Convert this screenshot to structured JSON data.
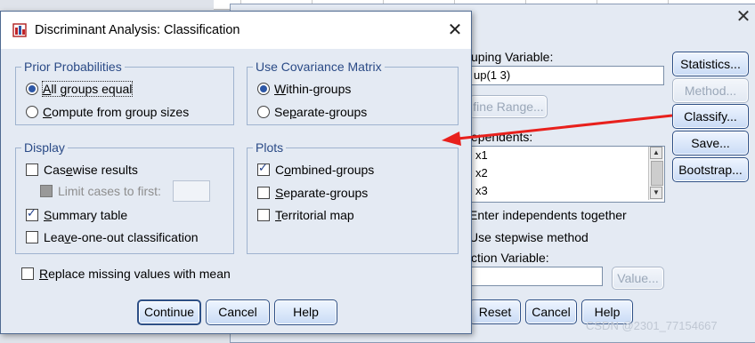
{
  "background_dialog": {
    "grouping_label": "uping Variable:",
    "grouping_value": "up(1 3)",
    "define_range_label": "fine Range...",
    "independents_label": "ependents:",
    "independents": [
      "x1",
      "x2",
      "x3"
    ],
    "enter_together_label": "Enter independents together",
    "stepwise_label": "Use stepwise method",
    "selection_label": "ction Variable:",
    "value_button": "Value...",
    "buttons": {
      "statistics": "Statistics...",
      "method": "Method...",
      "classify": "Classify...",
      "save": "Save...",
      "bootstrap": "Bootstrap..."
    },
    "bottom_buttons": {
      "reset": "Reset",
      "cancel": "Cancel",
      "help": "Help"
    },
    "close_glyph": "✕"
  },
  "dialog": {
    "title": "Discriminant Analysis: Classification",
    "close_glyph": "✕",
    "prior_probabilities": {
      "title": "Prior Probabilities",
      "options": [
        {
          "label_u": "A",
          "label_rest": "ll groups equal",
          "selected": true
        },
        {
          "label_u": "C",
          "label_rest": "ompute from group sizes",
          "selected": false
        }
      ]
    },
    "covariance": {
      "title": "Use Covariance Matrix",
      "options": [
        {
          "label_u": "W",
          "label_rest": "ithin-groups",
          "selected": true
        },
        {
          "label_pre": "Se",
          "label_u": "p",
          "label_rest": "arate-groups",
          "selected": false
        }
      ]
    },
    "display": {
      "title": "Display",
      "casewise": {
        "pre": "Cas",
        "u": "e",
        "rest": "wise results",
        "checked": false
      },
      "limit": {
        "label": "Limit cases to first:",
        "checked": false,
        "enabled": false
      },
      "summary": {
        "u": "S",
        "rest": "ummary table",
        "checked": true
      },
      "leave_one_out": {
        "pre": "Lea",
        "u": "v",
        "rest": "e-one-out classification",
        "checked": false
      }
    },
    "plots": {
      "title": "Plots",
      "combined": {
        "pre": "C",
        "u": "o",
        "rest": "mbined-groups",
        "checked": true
      },
      "separate": {
        "u": "S",
        "rest": "eparate-groups",
        "checked": false
      },
      "territorial": {
        "u": "T",
        "rest": "erritorial map",
        "checked": false
      }
    },
    "replace_missing": {
      "u": "R",
      "rest": "eplace missing values with mean",
      "checked": false
    },
    "buttons": {
      "continue": "Continue",
      "cancel": "Cancel",
      "help": "Help"
    }
  },
  "colors": {
    "accent": "#2d4f86",
    "group_title": "#2a4a86",
    "arrow": "#e8201c"
  },
  "watermark": "CSDN @2301_77154667"
}
